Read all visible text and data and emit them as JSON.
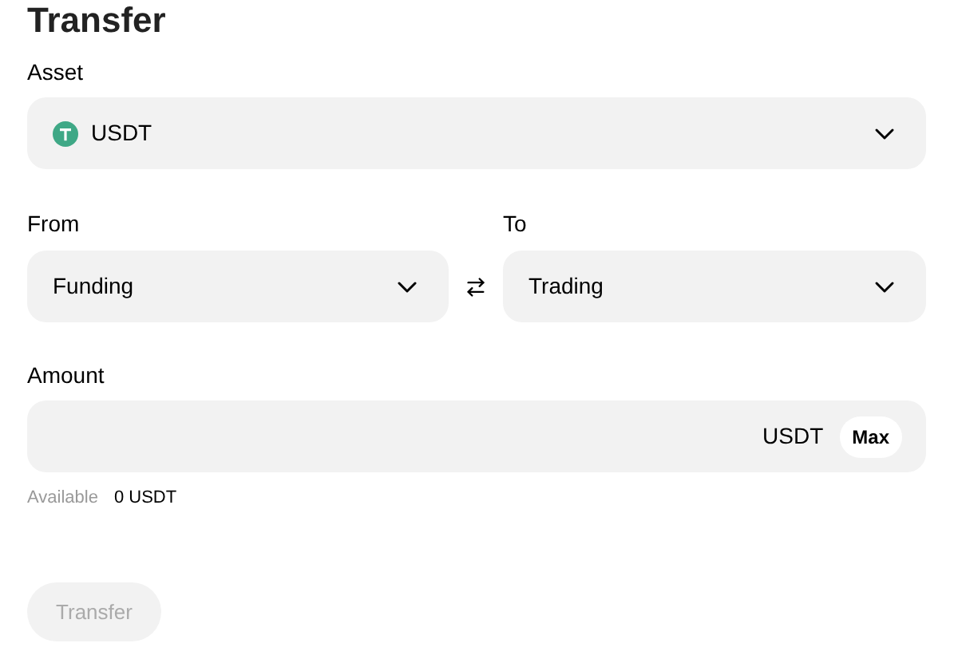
{
  "title": "Transfer",
  "asset": {
    "label": "Asset",
    "value": "USDT"
  },
  "from": {
    "label": "From",
    "value": "Funding"
  },
  "to": {
    "label": "To",
    "value": "Trading"
  },
  "amount": {
    "label": "Amount",
    "unit": "USDT",
    "max_button": "Max"
  },
  "available": {
    "label": "Available",
    "value": "0 USDT"
  },
  "submit": {
    "label": "Transfer",
    "disabled": true
  }
}
